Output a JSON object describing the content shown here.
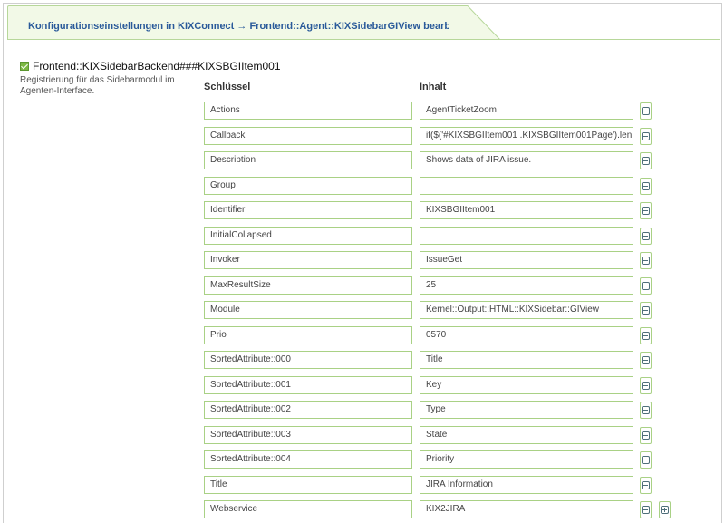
{
  "header": {
    "tab_title": "Konfigurationseinstellungen in KIXConnect → Frontend::Agent::KIXSidebarGIView bearbeiten"
  },
  "setting": {
    "name": "Frontend::KIXSidebarBackend###KIXSBGIItem001",
    "enabled": true,
    "description": "Registrierung für das Sidebarmodul im Agenten-Interface."
  },
  "table": {
    "key_header": "Schlüssel",
    "value_header": "Inhalt",
    "rows": [
      {
        "key": "Actions",
        "value": "AgentTicketZoom"
      },
      {
        "key": "Callback",
        "value": "if($('#KIXSBGIItem001 .KIXSBGIItem001Page').len"
      },
      {
        "key": "Description",
        "value": "Shows data of JIRA issue."
      },
      {
        "key": "Group",
        "value": ""
      },
      {
        "key": "Identifier",
        "value": "KIXSBGIItem001"
      },
      {
        "key": "InitialCollapsed",
        "value": ""
      },
      {
        "key": "Invoker",
        "value": "IssueGet"
      },
      {
        "key": "MaxResultSize",
        "value": "25"
      },
      {
        "key": "Module",
        "value": "Kernel::Output::HTML::KIXSidebar::GIView"
      },
      {
        "key": "Prio",
        "value": "0570"
      },
      {
        "key": "SortedAttribute::000",
        "value": "Title"
      },
      {
        "key": "SortedAttribute::001",
        "value": "Key"
      },
      {
        "key": "SortedAttribute::002",
        "value": "Type"
      },
      {
        "key": "SortedAttribute::003",
        "value": "State"
      },
      {
        "key": "SortedAttribute::004",
        "value": "Priority"
      },
      {
        "key": "Title",
        "value": "JIRA Information"
      },
      {
        "key": "Webservice",
        "value": "KIX2JIRA"
      }
    ]
  },
  "icons": {
    "remove": "minus-square-icon",
    "add": "plus-square-icon",
    "checkbox": "checkbox-checked-icon"
  },
  "colors": {
    "accent_green": "#a9d185",
    "title_blue": "#2a5a9a",
    "tab_bg": "#f2f9e7"
  }
}
